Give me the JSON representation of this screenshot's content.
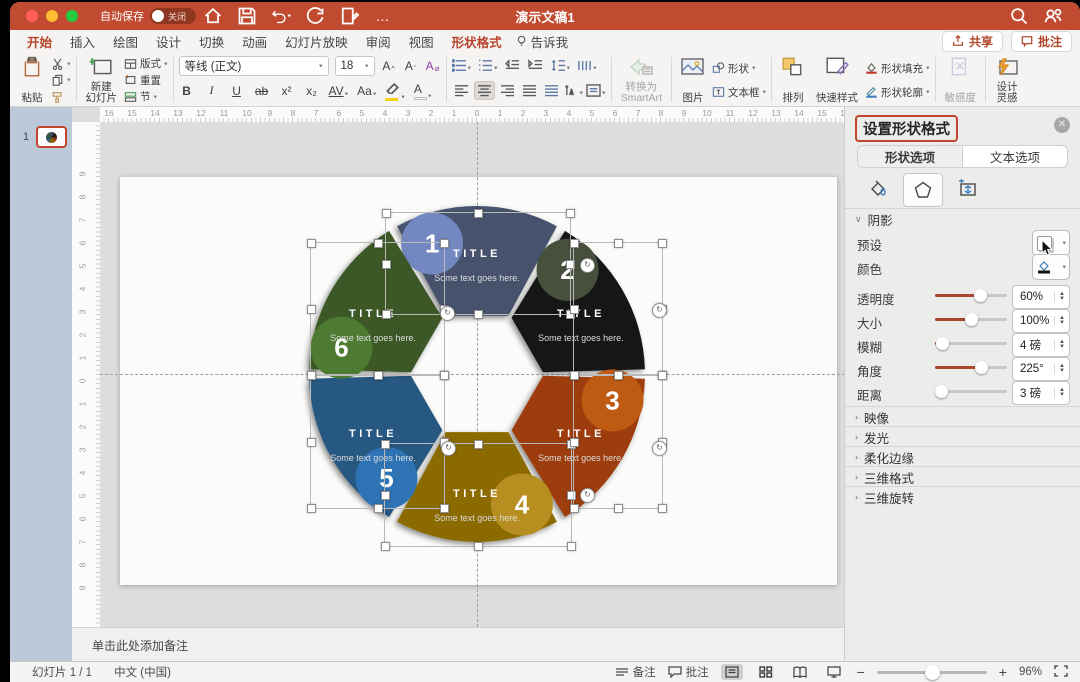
{
  "titlebar": {
    "autosave": "自动保存",
    "autosave_state": "关闭",
    "title": "演示文稿1"
  },
  "tabs": {
    "items": [
      "开始",
      "插入",
      "绘图",
      "设计",
      "切换",
      "动画",
      "幻灯片放映",
      "审阅",
      "视图",
      "形状格式"
    ],
    "active": "开始",
    "contextual": "形状格式",
    "tell_me": "告诉我",
    "share": "共享",
    "comments": "批注"
  },
  "ribbon": {
    "paste": "粘贴",
    "new_slide_1": "新建",
    "new_slide_2": "幻灯片",
    "layout": "版式",
    "reset": "重置",
    "section": "节",
    "font_name": "等线 (正文)",
    "font_size": "18",
    "smartart_1": "转换为",
    "smartart_2": "SmartArt",
    "picture": "图片",
    "shapes": "形状",
    "textbox": "文本框",
    "arrange": "排列",
    "quick_styles": "快速样式",
    "shape_fill": "形状填充",
    "shape_outline": "形状轮廓",
    "sensitivity": "敏感度",
    "design_1": "设计",
    "design_2": "灵感"
  },
  "slide_panel": {
    "number": "1"
  },
  "rulers": {
    "h": [
      16,
      15,
      14,
      13,
      12,
      11,
      10,
      9,
      8,
      7,
      6,
      5,
      4,
      3,
      2,
      1,
      0,
      1,
      2,
      3,
      4,
      5,
      6,
      7,
      8,
      9,
      10,
      11,
      12,
      13,
      14,
      15,
      16
    ],
    "v": [
      9,
      8,
      7,
      6,
      5,
      4,
      3,
      2,
      1,
      0,
      1,
      2,
      3,
      4,
      5,
      6,
      7,
      8,
      9
    ]
  },
  "canvas": {
    "notes_placeholder": "单击此处添加备注"
  },
  "diagram": {
    "title_text": "TITLE",
    "body_text": "Some text goes here.",
    "segments": [
      {
        "num": "1",
        "a1": 60,
        "a2": 120,
        "fill": "#46526d",
        "badge": "#7387c0"
      },
      {
        "num": "2",
        "a1": 0,
        "a2": 60,
        "fill": "#131313",
        "badge": "#46503c"
      },
      {
        "num": "3",
        "a1": -60,
        "a2": 0,
        "fill": "#9d3d10",
        "badge": "#bf5a12"
      },
      {
        "num": "4",
        "a1": 240,
        "a2": 300,
        "fill": "#8b6a03",
        "badge": "#b78e20"
      },
      {
        "num": "5",
        "a1": 180,
        "a2": 240,
        "fill": "#255882",
        "badge": "#2e73b4"
      },
      {
        "num": "6",
        "a1": 120,
        "a2": 180,
        "fill": "#3a5826",
        "badge": "#4e7b32"
      }
    ]
  },
  "format_pane": {
    "title": "设置形状格式",
    "tab_shape": "形状选项",
    "tab_text": "文本选项",
    "shadow_section": "阴影",
    "preset": "预设",
    "color": "颜色",
    "sliders": [
      {
        "label": "透明度",
        "value": "60%",
        "pct": 62
      },
      {
        "label": "大小",
        "value": "100%",
        "pct": 50
      },
      {
        "label": "模糊",
        "value": "4 磅",
        "pct": 10
      },
      {
        "label": "角度",
        "value": "225°",
        "pct": 64
      },
      {
        "label": "距离",
        "value": "3 磅",
        "pct": 8
      }
    ],
    "sections": [
      "映像",
      "发光",
      "柔化边缘",
      "三维格式",
      "三维旋转"
    ]
  },
  "statusbar": {
    "slide": "幻灯片 1 / 1",
    "lang": "中文 (中国)",
    "notes": "备注",
    "comments": "批注",
    "zoom": "96%"
  }
}
